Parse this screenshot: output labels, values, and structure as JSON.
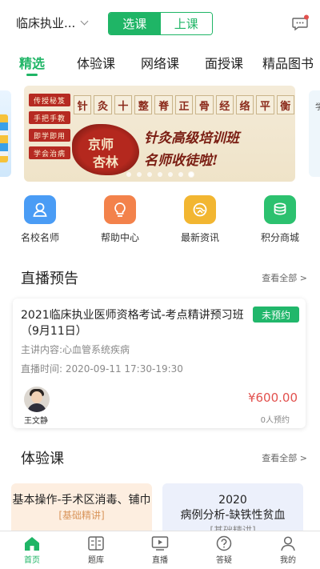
{
  "header": {
    "exam_selector": "临床执业...",
    "segment": {
      "active": "选课",
      "inactive": "上课"
    }
  },
  "tabs": [
    "精选",
    "体验课",
    "网络课",
    "面授课",
    "精品图书"
  ],
  "banner": {
    "stamps": [
      "传授秘笈",
      "手把手教",
      "即学即用",
      "学会治病"
    ],
    "ribbon": [
      "针",
      "灸",
      "十",
      "整",
      "脊",
      "正",
      "骨",
      "经",
      "络",
      "平",
      "衡"
    ],
    "seal": [
      "京师",
      "杏林"
    ],
    "slogan_1": "针灸高级培训班",
    "slogan_2": "名师收徒啦!",
    "right_card_text": "学",
    "slide_count": 7,
    "active_slide": 6
  },
  "quick_links": [
    {
      "label": "名校名师",
      "icon": "teacher-icon",
      "color": "#4a9cf5"
    },
    {
      "label": "帮助中心",
      "icon": "lightbulb-icon",
      "color": "#f3824b"
    },
    {
      "label": "最新资讯",
      "icon": "news-icon",
      "color": "#f2b631"
    },
    {
      "label": "积分商城",
      "icon": "coins-icon",
      "color": "#2cc16f"
    }
  ],
  "live": {
    "section_title": "直播预告",
    "view_all": "查看全部 >",
    "card": {
      "title": "2021临床执业医师资格考试-考点精讲预习班（9月11日）",
      "status": "未预约",
      "content": "主讲内容:心血管系统疾病",
      "time": "直播时间: 2020-09-11 17:30-19:30",
      "teacher": "王文静",
      "price": "¥600.00",
      "booked": "0人预约"
    }
  },
  "trial": {
    "section_title": "体验课",
    "view_all": "查看全部 >",
    "courses": [
      {
        "title": "基本操作-手术区消毒、铺巾",
        "tag": "[基础精讲]"
      },
      {
        "title": "2020\n病例分析-缺铁性贫血",
        "tag": "[基础精讲]"
      }
    ]
  },
  "bottom_nav": [
    {
      "label": "首页",
      "icon": "home-icon"
    },
    {
      "label": "题库",
      "icon": "question-bank-icon"
    },
    {
      "label": "直播",
      "icon": "live-icon"
    },
    {
      "label": "答疑",
      "icon": "qa-icon"
    },
    {
      "label": "我的",
      "icon": "profile-icon"
    }
  ],
  "colors": {
    "accent": "#1fb566",
    "price": "#e2514e"
  }
}
